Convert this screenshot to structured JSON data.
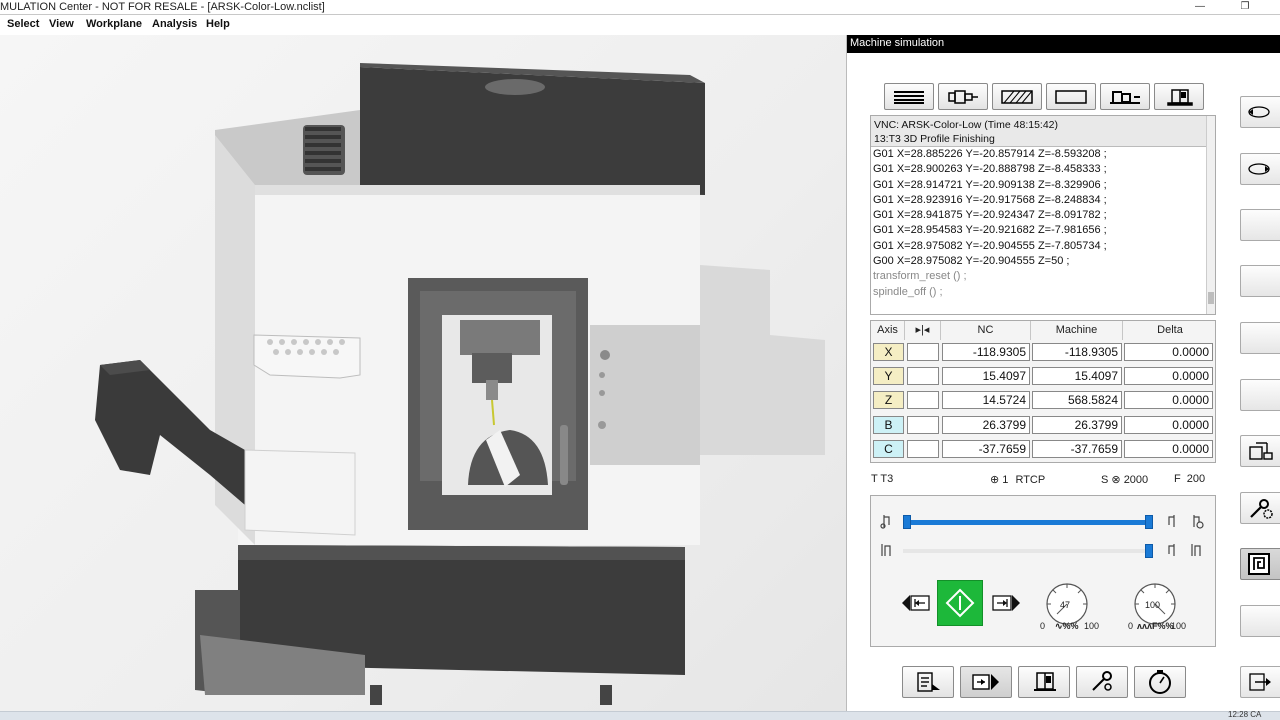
{
  "window": {
    "title": "MULATION Center - NOT FOR RESALE - [ARSK-Color-Low.nclist]",
    "minimize_glyph": "—",
    "restore_glyph": "❐"
  },
  "menu": [
    "Select",
    "View",
    "Workplane",
    "Analysis",
    "Help"
  ],
  "panel": {
    "title": "Machine simulation",
    "top_buttons": [
      "list-lines-icon",
      "tool-holder-icon",
      "stock-hatch-icon",
      "blank-frame-icon",
      "machine-table-icon",
      "machine-cabinet-icon"
    ],
    "nc": {
      "header_line1": "VNC: ARSK-Color-Low (Time 48:15:42)",
      "header_line2": "13:T3 3D Profile Finishing",
      "lines": [
        "G01 X=28.885226 Y=-20.857914 Z=-8.593208 ;",
        "G01 X=28.900263 Y=-20.888798 Z=-8.458333 ;",
        "G01 X=28.914721 Y=-20.909138 Z=-8.329906 ;",
        "G01 X=28.923916 Y=-20.917568 Z=-8.248834 ;",
        "G01 X=28.941875 Y=-20.924347 Z=-8.091782 ;",
        "G01 X=28.954583 Y=-20.921682 Z=-7.981656 ;",
        "G01 X=28.975082 Y=-20.904555 Z=-7.805734 ;",
        "G00 X=28.975082 Y=-20.904555 Z=50 ;",
        "transform_reset () ;",
        "spindle_off () ;"
      ]
    },
    "axes": {
      "headers": {
        "axis": "Axis",
        "mode": "▸|◂",
        "nc": "NC",
        "machine": "Machine",
        "delta": "Delta"
      },
      "rows": [
        {
          "axis": "X",
          "nc": "-118.9305",
          "machine": "-118.9305",
          "delta": "0.0000",
          "color": "#f5eec4"
        },
        {
          "axis": "Y",
          "nc": "15.4097",
          "machine": "15.4097",
          "delta": "0.0000",
          "color": "#f5eec4"
        },
        {
          "axis": "Z",
          "nc": "14.5724",
          "machine": "568.5824",
          "delta": "0.0000",
          "color": "#f5eec4"
        },
        {
          "axis": "B",
          "nc": "26.3799",
          "machine": "26.3799",
          "delta": "0.0000",
          "color": "#cdf1f6"
        },
        {
          "axis": "C",
          "nc": "-37.7659",
          "machine": "-37.7659",
          "delta": "0.0000",
          "color": "#cdf1f6"
        }
      ]
    },
    "status": {
      "tool": "T T3",
      "rtcp_num": "1",
      "rtcp_label": "RTCP",
      "spindle_label": "S",
      "spindle": "2000",
      "feed_label": "F",
      "feed": "200"
    },
    "controls": {
      "slider1_fraction": 1.0,
      "slider2_fraction": 1.0,
      "dial1": {
        "value": "47",
        "min": "0",
        "max": "100",
        "label": "%%"
      },
      "dial2": {
        "value": "100",
        "min": "0",
        "max": "100",
        "label": "F%%"
      }
    },
    "bottom_buttons": [
      "report-icon",
      "step-forward-icon",
      "machine-control-icon",
      "tool-settings-icon",
      "stopwatch-icon"
    ],
    "side_buttons": [
      "rotate-view-icon",
      "rotate-view-2-icon",
      "blank-icon",
      "blank-icon",
      "blank-icon",
      "blank-icon",
      "machine-setup-icon",
      "settings-gear-icon",
      "spiral-path-icon",
      "blank-icon",
      "export-icon"
    ]
  },
  "taskbar": {
    "clock": "12:28 CA"
  }
}
